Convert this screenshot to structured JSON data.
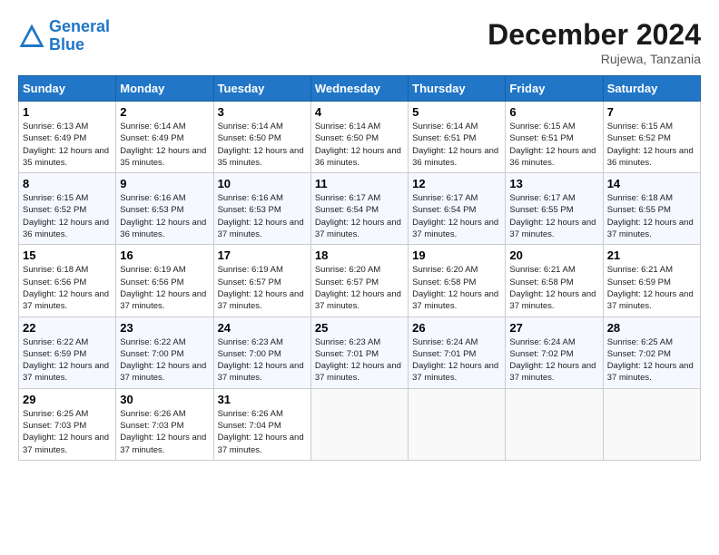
{
  "header": {
    "logo_line1": "General",
    "logo_line2": "Blue",
    "month_title": "December 2024",
    "location": "Rujewa, Tanzania"
  },
  "weekdays": [
    "Sunday",
    "Monday",
    "Tuesday",
    "Wednesday",
    "Thursday",
    "Friday",
    "Saturday"
  ],
  "weeks": [
    [
      {
        "day": "1",
        "sunrise": "6:13 AM",
        "sunset": "6:49 PM",
        "daylight": "12 hours and 35 minutes."
      },
      {
        "day": "2",
        "sunrise": "6:14 AM",
        "sunset": "6:49 PM",
        "daylight": "12 hours and 35 minutes."
      },
      {
        "day": "3",
        "sunrise": "6:14 AM",
        "sunset": "6:50 PM",
        "daylight": "12 hours and 35 minutes."
      },
      {
        "day": "4",
        "sunrise": "6:14 AM",
        "sunset": "6:50 PM",
        "daylight": "12 hours and 36 minutes."
      },
      {
        "day": "5",
        "sunrise": "6:14 AM",
        "sunset": "6:51 PM",
        "daylight": "12 hours and 36 minutes."
      },
      {
        "day": "6",
        "sunrise": "6:15 AM",
        "sunset": "6:51 PM",
        "daylight": "12 hours and 36 minutes."
      },
      {
        "day": "7",
        "sunrise": "6:15 AM",
        "sunset": "6:52 PM",
        "daylight": "12 hours and 36 minutes."
      }
    ],
    [
      {
        "day": "8",
        "sunrise": "6:15 AM",
        "sunset": "6:52 PM",
        "daylight": "12 hours and 36 minutes."
      },
      {
        "day": "9",
        "sunrise": "6:16 AM",
        "sunset": "6:53 PM",
        "daylight": "12 hours and 36 minutes."
      },
      {
        "day": "10",
        "sunrise": "6:16 AM",
        "sunset": "6:53 PM",
        "daylight": "12 hours and 37 minutes."
      },
      {
        "day": "11",
        "sunrise": "6:17 AM",
        "sunset": "6:54 PM",
        "daylight": "12 hours and 37 minutes."
      },
      {
        "day": "12",
        "sunrise": "6:17 AM",
        "sunset": "6:54 PM",
        "daylight": "12 hours and 37 minutes."
      },
      {
        "day": "13",
        "sunrise": "6:17 AM",
        "sunset": "6:55 PM",
        "daylight": "12 hours and 37 minutes."
      },
      {
        "day": "14",
        "sunrise": "6:18 AM",
        "sunset": "6:55 PM",
        "daylight": "12 hours and 37 minutes."
      }
    ],
    [
      {
        "day": "15",
        "sunrise": "6:18 AM",
        "sunset": "6:56 PM",
        "daylight": "12 hours and 37 minutes."
      },
      {
        "day": "16",
        "sunrise": "6:19 AM",
        "sunset": "6:56 PM",
        "daylight": "12 hours and 37 minutes."
      },
      {
        "day": "17",
        "sunrise": "6:19 AM",
        "sunset": "6:57 PM",
        "daylight": "12 hours and 37 minutes."
      },
      {
        "day": "18",
        "sunrise": "6:20 AM",
        "sunset": "6:57 PM",
        "daylight": "12 hours and 37 minutes."
      },
      {
        "day": "19",
        "sunrise": "6:20 AM",
        "sunset": "6:58 PM",
        "daylight": "12 hours and 37 minutes."
      },
      {
        "day": "20",
        "sunrise": "6:21 AM",
        "sunset": "6:58 PM",
        "daylight": "12 hours and 37 minutes."
      },
      {
        "day": "21",
        "sunrise": "6:21 AM",
        "sunset": "6:59 PM",
        "daylight": "12 hours and 37 minutes."
      }
    ],
    [
      {
        "day": "22",
        "sunrise": "6:22 AM",
        "sunset": "6:59 PM",
        "daylight": "12 hours and 37 minutes."
      },
      {
        "day": "23",
        "sunrise": "6:22 AM",
        "sunset": "7:00 PM",
        "daylight": "12 hours and 37 minutes."
      },
      {
        "day": "24",
        "sunrise": "6:23 AM",
        "sunset": "7:00 PM",
        "daylight": "12 hours and 37 minutes."
      },
      {
        "day": "25",
        "sunrise": "6:23 AM",
        "sunset": "7:01 PM",
        "daylight": "12 hours and 37 minutes."
      },
      {
        "day": "26",
        "sunrise": "6:24 AM",
        "sunset": "7:01 PM",
        "daylight": "12 hours and 37 minutes."
      },
      {
        "day": "27",
        "sunrise": "6:24 AM",
        "sunset": "7:02 PM",
        "daylight": "12 hours and 37 minutes."
      },
      {
        "day": "28",
        "sunrise": "6:25 AM",
        "sunset": "7:02 PM",
        "daylight": "12 hours and 37 minutes."
      }
    ],
    [
      {
        "day": "29",
        "sunrise": "6:25 AM",
        "sunset": "7:03 PM",
        "daylight": "12 hours and 37 minutes."
      },
      {
        "day": "30",
        "sunrise": "6:26 AM",
        "sunset": "7:03 PM",
        "daylight": "12 hours and 37 minutes."
      },
      {
        "day": "31",
        "sunrise": "6:26 AM",
        "sunset": "7:04 PM",
        "daylight": "12 hours and 37 minutes."
      },
      null,
      null,
      null,
      null
    ]
  ]
}
